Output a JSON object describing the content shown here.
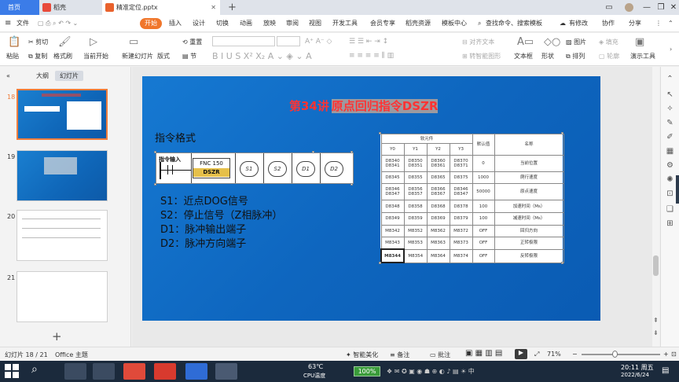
{
  "tabs": {
    "home": "首页",
    "shell": "稻壳",
    "file": "精准定位.pptx"
  },
  "menu": [
    "文件",
    "开始",
    "插入",
    "设计",
    "切换",
    "动画",
    "放映",
    "审阅",
    "视图",
    "开发工具",
    "会员专享",
    "稻壳资源",
    "模板中心"
  ],
  "menu_search": "查找命令、搜索模板",
  "menu_right": {
    "backup": "有修改",
    "collab": "协作",
    "share": "分享"
  },
  "ribbon": {
    "paste": "粘贴",
    "cut": "剪切",
    "copy": "复制",
    "format_brush": "格式刷",
    "from_current": "当前开始",
    "new_slide": "新建幻灯片",
    "layout": "版式",
    "section": "节",
    "reset": "重置",
    "align_text": "对齐文本",
    "convert_smartart": "转智能图形",
    "textbox": "文本框",
    "shape": "形状",
    "picture": "图片",
    "fill": "填充",
    "arrange": "排列",
    "outline": "轮廓",
    "slideshow": "演示工具"
  },
  "panel_tabs": {
    "outline": "大纲",
    "slides": "幻灯片"
  },
  "thumb_numbers": [
    "18",
    "19",
    "20",
    "21"
  ],
  "slide": {
    "title_a": "第34讲",
    "title_b": "原点回归指令DSZR",
    "format_heading": "指令格式",
    "instr_input": "指令输入",
    "fnc": "FNC 150",
    "dszr": "DSZR",
    "ops": [
      "S1",
      "S2",
      "D1",
      "D2"
    ],
    "params": [
      "S1：近点DOG信号",
      "S2：停止信号（Z相脉冲）",
      "D1：脉冲输出端子",
      "D2：脉冲方向端子"
    ]
  },
  "table": {
    "soft_header": "软元件",
    "cols": [
      "Y0",
      "Y1",
      "Y2",
      "Y3"
    ],
    "default_header": "默认值",
    "name_header": "名称",
    "rows": [
      {
        "y0": "D8340\nD8341",
        "y1": "D8350\nD8351",
        "y2": "D8360\nD8361",
        "y3": "D8370\nD8371",
        "def": "0",
        "name": "当前位置"
      },
      {
        "y0": "D8345",
        "y1": "D8355",
        "y2": "D8365",
        "y3": "D8375",
        "def": "1000",
        "name": "爬行速度"
      },
      {
        "y0": "D8346\nD8347",
        "y1": "D8356\nD8357",
        "y2": "D8366\nD8367",
        "y3": "D8346\nD8347",
        "def": "50000",
        "name": "原点速度"
      },
      {
        "y0": "D8348",
        "y1": "D8358",
        "y2": "D8368",
        "y3": "D8378",
        "def": "100",
        "name": "加速时间（Ms）"
      },
      {
        "y0": "D8349",
        "y1": "D8359",
        "y2": "D8369",
        "y3": "D8379",
        "def": "100",
        "name": "减速时间（Ms）"
      },
      {
        "y0": "M8342",
        "y1": "M8352",
        "y2": "M8362",
        "y3": "M8372",
        "def": "OFF",
        "name": "回归方向"
      },
      {
        "y0": "M8343",
        "y1": "M8353",
        "y2": "M8363",
        "y3": "M8373",
        "def": "OFF",
        "name": "正转极限"
      },
      {
        "y0": "M8344",
        "y1": "M8354",
        "y2": "M8364",
        "y3": "M8374",
        "def": "OFF",
        "name": "反转极限"
      }
    ]
  },
  "status": {
    "slide_counter": "幻灯片 18 / 21",
    "theme": "Office 主题",
    "beautify": "智能美化",
    "notes": "备注",
    "comments": "批注",
    "zoom": "71%"
  },
  "taskbar": {
    "temp": "63℃",
    "cpu": "CPU温度",
    "battery": "100%",
    "time": "20:11 周五",
    "date": "2022/6/24"
  },
  "colors": {
    "accent_orange": "#f0762b",
    "slide_blue": "#1679d2",
    "title_red": "#ff3333"
  }
}
